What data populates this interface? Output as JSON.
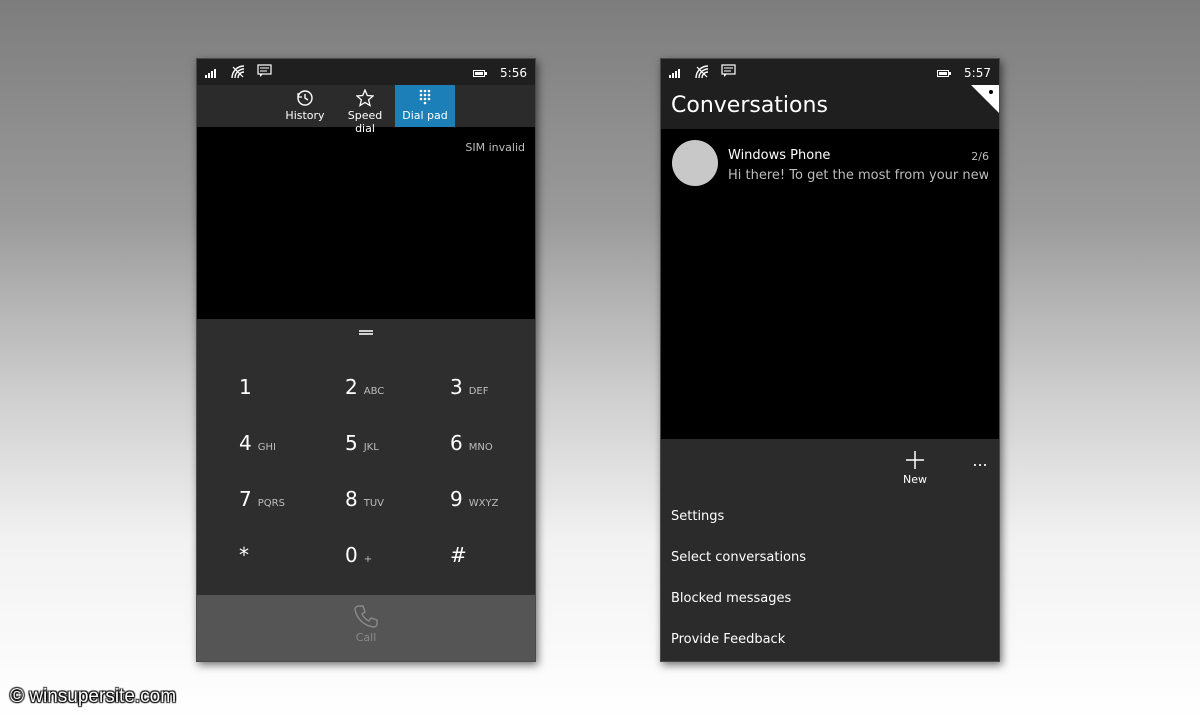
{
  "left_phone": {
    "status": {
      "time": "5:56"
    },
    "tabs": [
      {
        "label": "History",
        "icon": "history-icon"
      },
      {
        "label": "Speed dial",
        "icon": "star-icon"
      },
      {
        "label": "Dial pad",
        "icon": "dialpad-icon",
        "active": true
      }
    ],
    "sim_status": "SIM invalid",
    "keys": [
      {
        "digit": "1",
        "letters": ""
      },
      {
        "digit": "2",
        "letters": "ABC"
      },
      {
        "digit": "3",
        "letters": "DEF"
      },
      {
        "digit": "4",
        "letters": "GHI"
      },
      {
        "digit": "5",
        "letters": "JKL"
      },
      {
        "digit": "6",
        "letters": "MNO"
      },
      {
        "digit": "7",
        "letters": "PQRS"
      },
      {
        "digit": "8",
        "letters": "TUV"
      },
      {
        "digit": "9",
        "letters": "WXYZ"
      },
      {
        "digit": "*",
        "letters": ""
      },
      {
        "digit": "0",
        "letters": "+"
      },
      {
        "digit": "#",
        "letters": ""
      }
    ],
    "call_label": "Call"
  },
  "right_phone": {
    "status": {
      "time": "5:57"
    },
    "title": "Conversations",
    "conversations": [
      {
        "name": "Windows Phone",
        "date": "2/6",
        "preview": "Hi there! To get the most from your new p"
      }
    ],
    "app_bar": {
      "new_label": "New",
      "more_glyph": "..."
    },
    "menu": [
      "Settings",
      "Select conversations",
      "Blocked messages",
      "Provide Feedback"
    ]
  },
  "watermark": "© winsupersite.com",
  "colors": {
    "accent": "#1c7fb8",
    "keypad_bg": "#2e2e2e",
    "call_bar_bg": "#555555",
    "app_bar_bg": "#2b2b2b"
  }
}
